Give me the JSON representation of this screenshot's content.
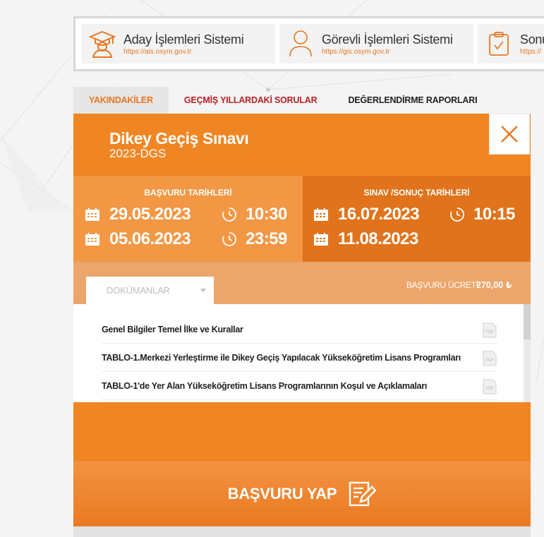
{
  "systems": [
    {
      "name": "Aday İşlemleri Sistemi",
      "url": "https://ais.osym.gov.tr",
      "icon": "graduate-icon"
    },
    {
      "name": "Görevli İşlemleri Sistemi",
      "url": "https://gis.osym.gov.tr",
      "icon": "user-icon"
    },
    {
      "name": "Sonuç",
      "url": "https://",
      "icon": "clipboard-check-icon"
    }
  ],
  "tabs": [
    {
      "label": "YAKINDAKİLER",
      "active": true
    },
    {
      "label": "GEÇMİŞ YILLARDAKİ SORULAR",
      "active": false
    },
    {
      "label": "DEĞERLENDİRME RAPORLARI",
      "active": false
    }
  ],
  "exam": {
    "title": "Dikey Geçiş Sınavı",
    "code": "2023-DGS"
  },
  "application_dates": {
    "heading": "BAŞVURU TARİHLERİ",
    "start_date": "29.05.2023",
    "start_time": "10:30",
    "end_date": "05.06.2023",
    "end_time": "23:59"
  },
  "exam_dates": {
    "heading": "SINAV /SONUÇ TARİHLERİ",
    "exam_date": "16.07.2023",
    "exam_time": "10:15",
    "result_date": "11.08.2023"
  },
  "documents": {
    "tab_label": "DOKÜMANLAR",
    "fee_label": "BAŞVURU ÜCRETİ",
    "fee_value": "270,00 ₺",
    "pdf_label": "PDF",
    "items": [
      "Genel Bilgiler Temel İlke ve Kurallar",
      "TABLO-1.Merkezi Yerleştirme ile Dikey Geçiş Yapılacak Yükseköğretim Lisans Programları",
      "TABLO-1'de Yer Alan Yükseköğretim Lisans Programlarının Koşul ve Açıklamaları"
    ]
  },
  "apply_button": {
    "label": "BAŞVURU YAP"
  },
  "colors": {
    "orange": "#ef8623",
    "orange_light": "#f29744",
    "orange_dark": "#e0731b",
    "tab_red": "#b51f24"
  }
}
